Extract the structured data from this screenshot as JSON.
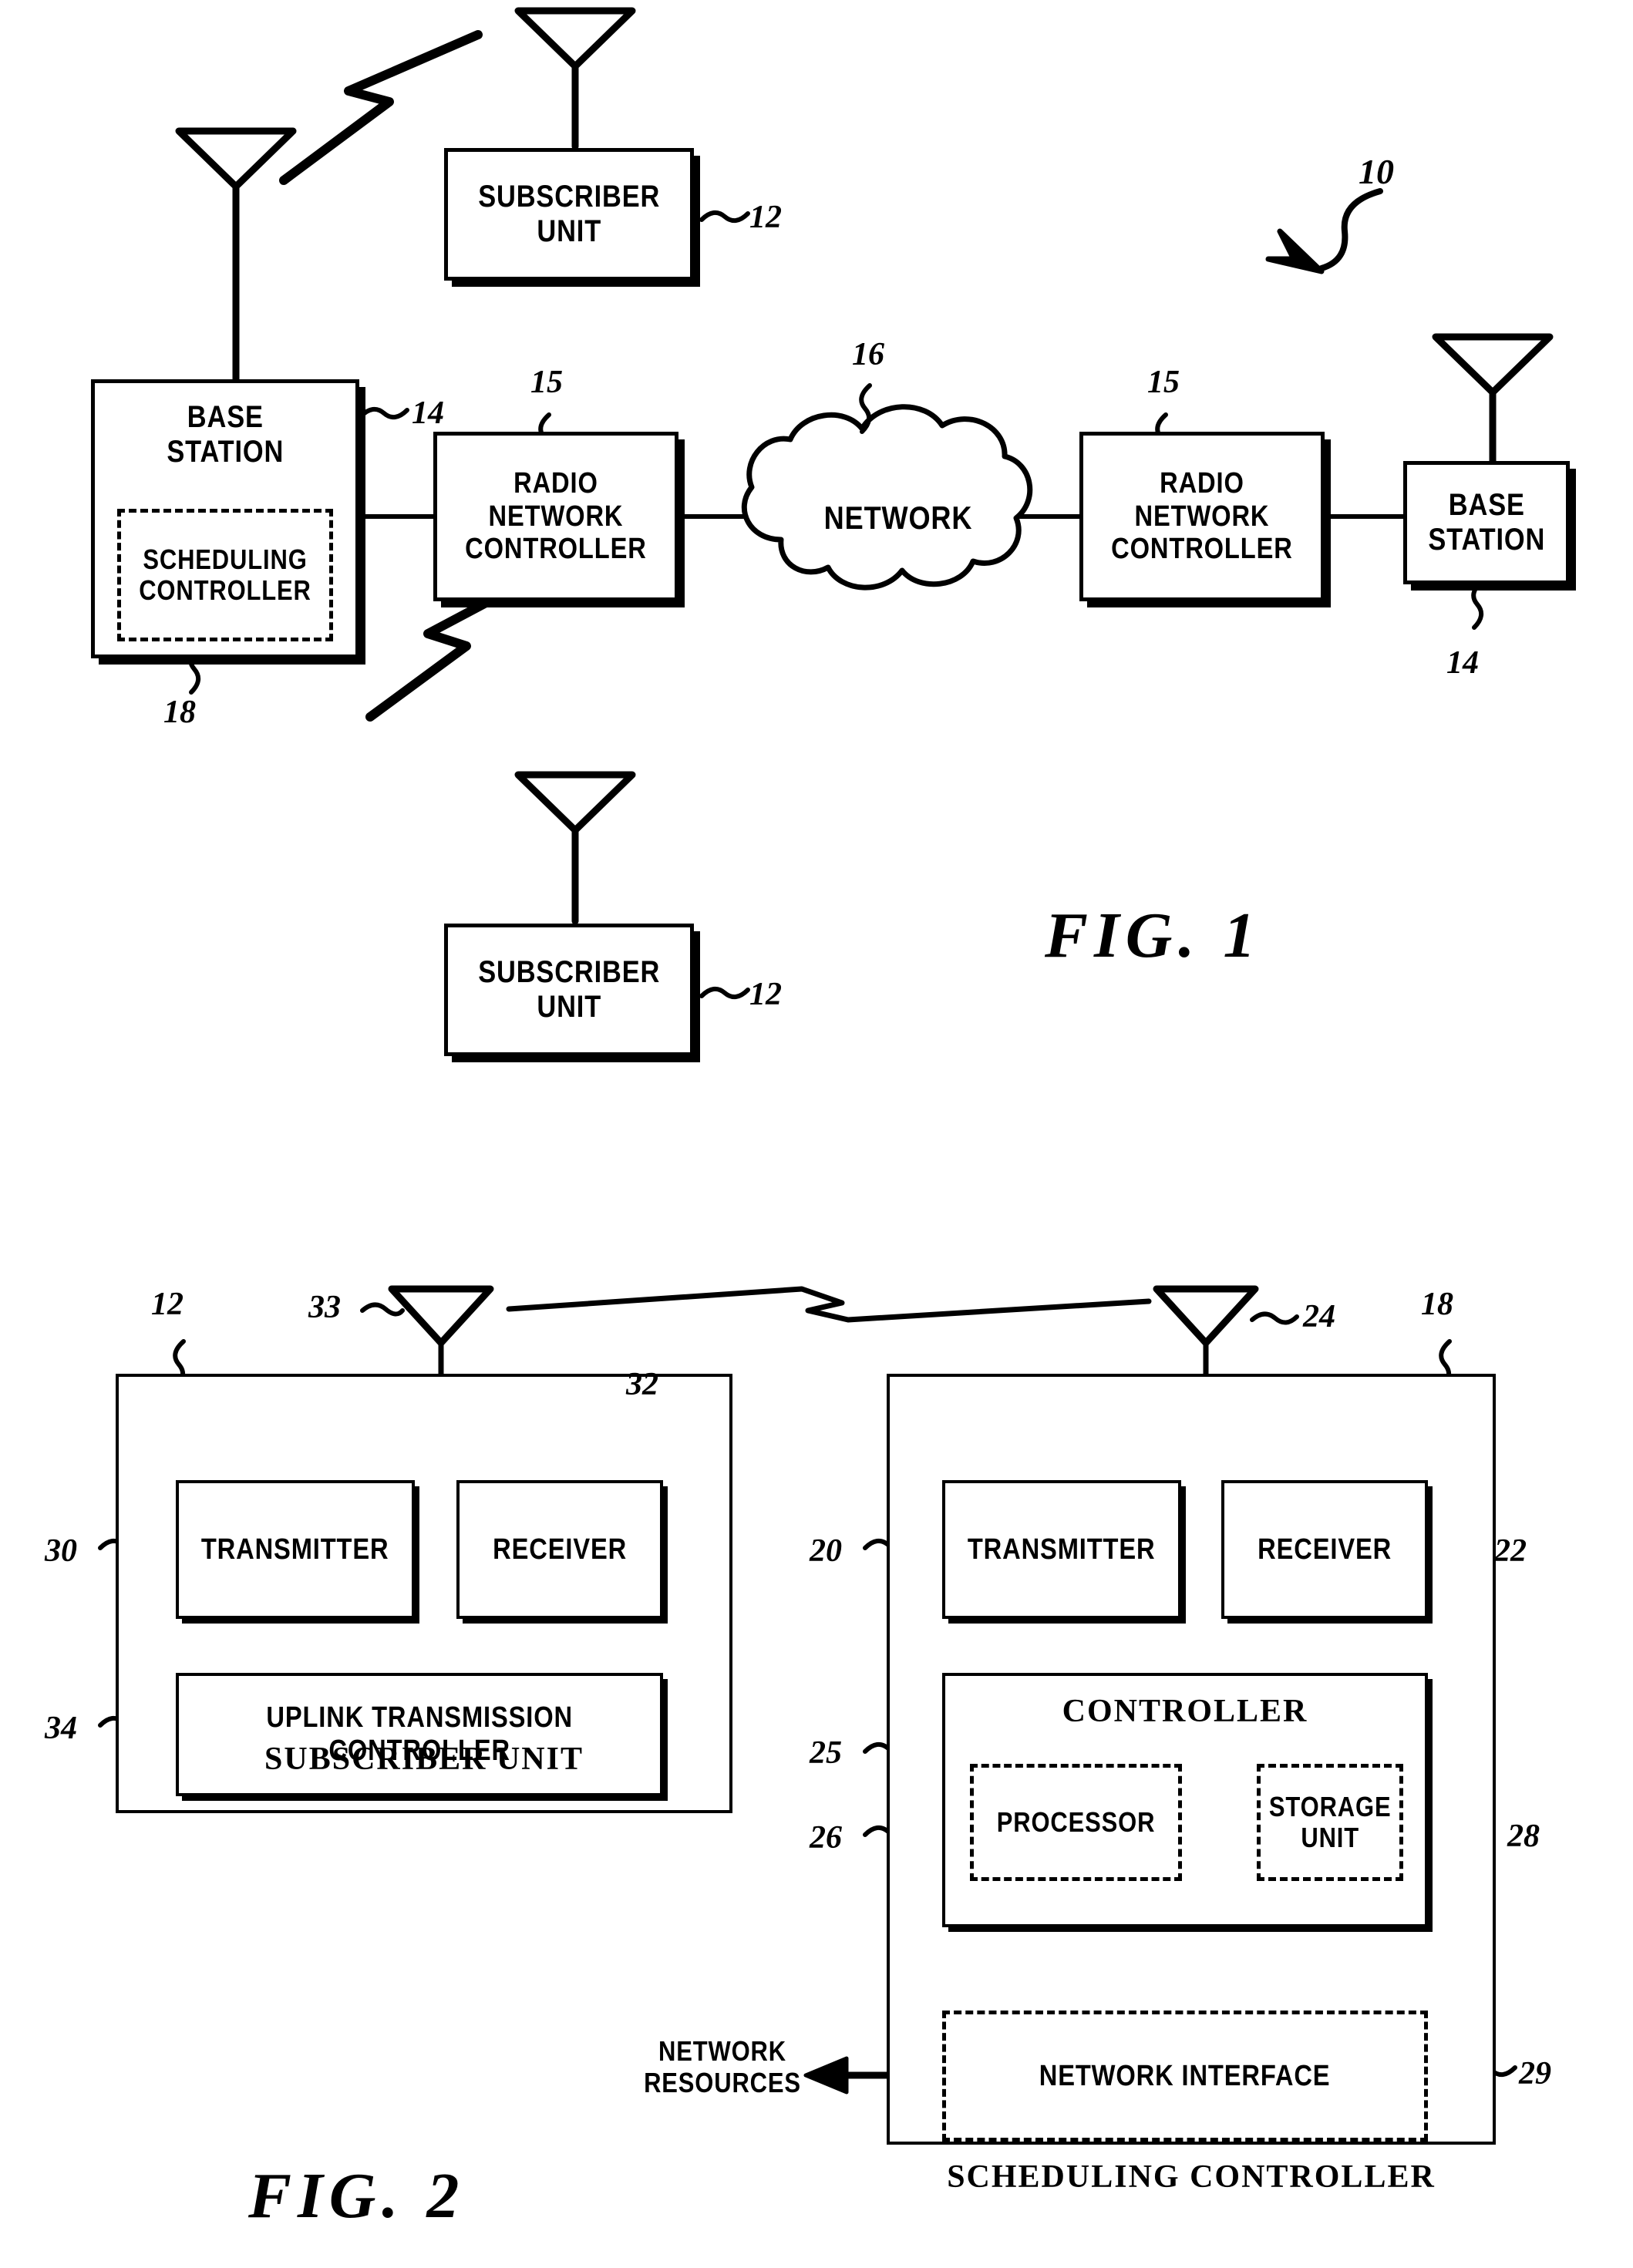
{
  "document": {
    "kind": "patent-figure-sheet",
    "figures": [
      "FIG. 1",
      "FIG. 2"
    ]
  },
  "fig1": {
    "label": "FIG. 1",
    "system_ref": "10",
    "blocks": {
      "subscriber_top": {
        "text": "SUBSCRIBER\nUNIT",
        "ref": "12"
      },
      "subscriber_bottom": {
        "text": "SUBSCRIBER\nUNIT",
        "ref": "12"
      },
      "base_station_left": {
        "text": "BASE\nSTATION",
        "ref": "14"
      },
      "scheduling_controller": {
        "text": "SCHEDULING\nCONTROLLER",
        "ref": "18"
      },
      "rnc_left": {
        "text": "RADIO\nNETWORK\nCONTROLLER",
        "ref": "15"
      },
      "network_cloud": {
        "text": "NETWORK",
        "ref": "16"
      },
      "rnc_right": {
        "text": "RADIO\nNETWORK\nCONTROLLER",
        "ref": "15"
      },
      "base_station_right": {
        "text": "BASE\nSTATION",
        "ref": "14"
      }
    },
    "icons": {
      "antenna": "antenna-icon",
      "rf_link": "lightning-bolt-icon",
      "cloud": "cloud-icon",
      "lead_line": "curly-lead-line"
    }
  },
  "fig2": {
    "label": "FIG. 2",
    "subscriber_panel": {
      "title": "SUBSCRIBER UNIT",
      "ref": "12",
      "antenna_ref": "33",
      "blocks": [
        {
          "text": "TRANSMITTER",
          "ref": "30"
        },
        {
          "text": "RECEIVER",
          "ref": "32"
        },
        {
          "text": "UPLINK TRANSMISSION\nCONTROLLER",
          "ref": "34"
        }
      ]
    },
    "scheduling_panel": {
      "title": "SCHEDULING CONTROLLER",
      "ref": "18",
      "antenna_ref": "24",
      "blocks": [
        {
          "text": "TRANSMITTER",
          "ref": "20"
        },
        {
          "text": "RECEIVER",
          "ref": "22"
        },
        {
          "text": "CONTROLLER",
          "ref": "25"
        },
        {
          "text": "PROCESSOR",
          "ref": "26",
          "dashed": true
        },
        {
          "text": "STORAGE\nUNIT",
          "ref": "28",
          "dashed": true
        },
        {
          "text": "NETWORK INTERFACE",
          "ref": "29",
          "dashed": true
        }
      ],
      "network_resources_label": "NETWORK\nRESOURCES"
    },
    "icons": {
      "antenna": "antenna-icon",
      "rf_link": "lightning-bolt-icon",
      "junction_dot": "junction-dot-icon",
      "arrow": "arrow-left-icon"
    }
  },
  "colors": {
    "ink": "#000000",
    "paper": "#ffffff"
  }
}
